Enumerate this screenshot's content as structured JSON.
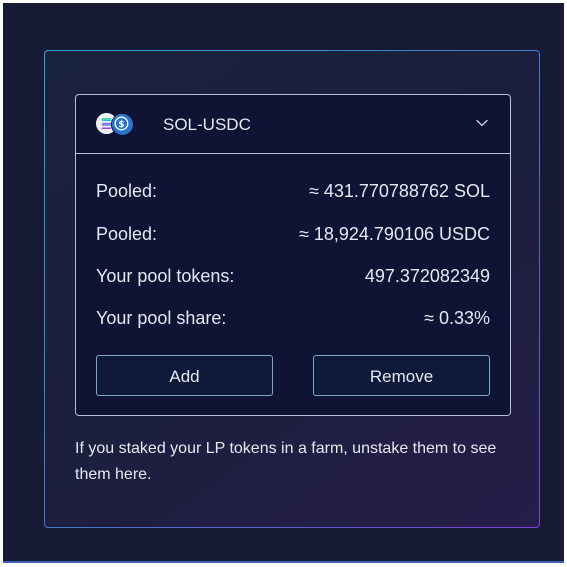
{
  "pool": {
    "pair_name": "SOL-USDC",
    "icons": [
      "solana-icon",
      "usdc-icon",
      "chevron-down-icon"
    ],
    "rows": [
      {
        "label": "Pooled:",
        "value": "≈ 431.770788762 SOL"
      },
      {
        "label": "Pooled:",
        "value": "≈ 18,924.790106 USDC"
      },
      {
        "label": "Your pool tokens:",
        "value": "497.372082349"
      },
      {
        "label": "Your pool share:",
        "value": "≈ 0.33%"
      }
    ],
    "add_label": "Add",
    "remove_label": "Remove"
  },
  "note": "If you staked your LP tokens in a farm, unstake them to see them here.",
  "colors": {
    "background": "#161a34",
    "card": "#0f1334",
    "accent_cyan": "#2fa6c8",
    "accent_purple": "#7a3fd8",
    "usdc_blue": "#2775ca"
  }
}
